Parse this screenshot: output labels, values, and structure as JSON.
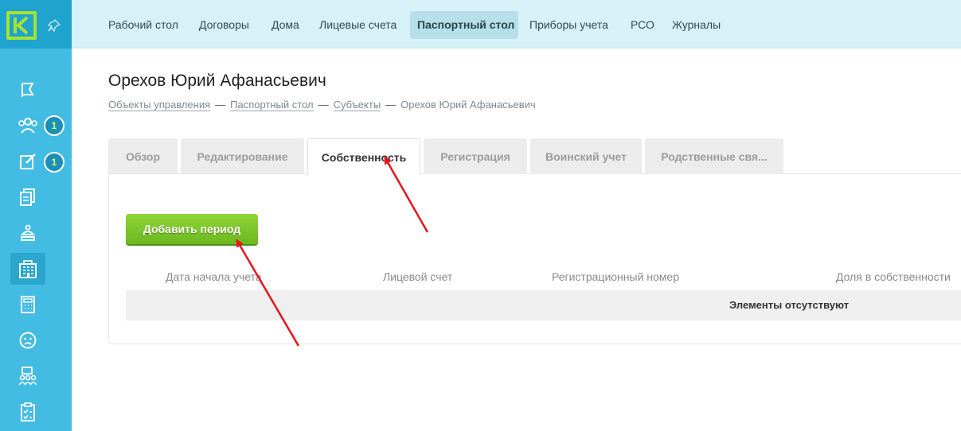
{
  "nav": {
    "items": [
      {
        "label": "Рабочий стол"
      },
      {
        "label": "Договоры"
      },
      {
        "label": "Дома"
      },
      {
        "label": "Лицевые счета"
      },
      {
        "label": "Паспортный стол"
      },
      {
        "label": "Приборы учета"
      },
      {
        "label": "РСО"
      },
      {
        "label": "Журналы"
      }
    ],
    "active": "Паспортный стол"
  },
  "sidebar": {
    "badges": [
      "1",
      "1"
    ],
    "icons": [
      "flag-icon",
      "users-icon",
      "edit-icon",
      "documents-icon",
      "lamp-icon",
      "building-icon",
      "calculator-icon",
      "sad-face-icon",
      "group-chat-icon",
      "clipboard-check-icon"
    ]
  },
  "page": {
    "title": "Орехов Юрий Афанасьевич",
    "breadcrumb": [
      "Объекты управления",
      "Паспортный стол",
      "Субъекты",
      "Орехов Юрий Афанасьевич"
    ],
    "breadcrumb_sep": "—"
  },
  "tabs": [
    {
      "label": "Обзор"
    },
    {
      "label": "Редактирование"
    },
    {
      "label": "Собственность"
    },
    {
      "label": "Регистрация"
    },
    {
      "label": "Воинский учет"
    },
    {
      "label": "Родственные свя..."
    }
  ],
  "active_tab": "Собственность",
  "content": {
    "add_button": "Добавить период",
    "columns": [
      "Дата начала учета",
      "Лицевой счет",
      "Регистрационный номер",
      "Доля в собственности"
    ],
    "empty_text": "Элементы отсутствуют"
  },
  "colors": {
    "sidebar": "#42bce2",
    "topnav": "#d7f1f8",
    "accent_green": "#7ac52a",
    "arrow": "#e8141b"
  }
}
